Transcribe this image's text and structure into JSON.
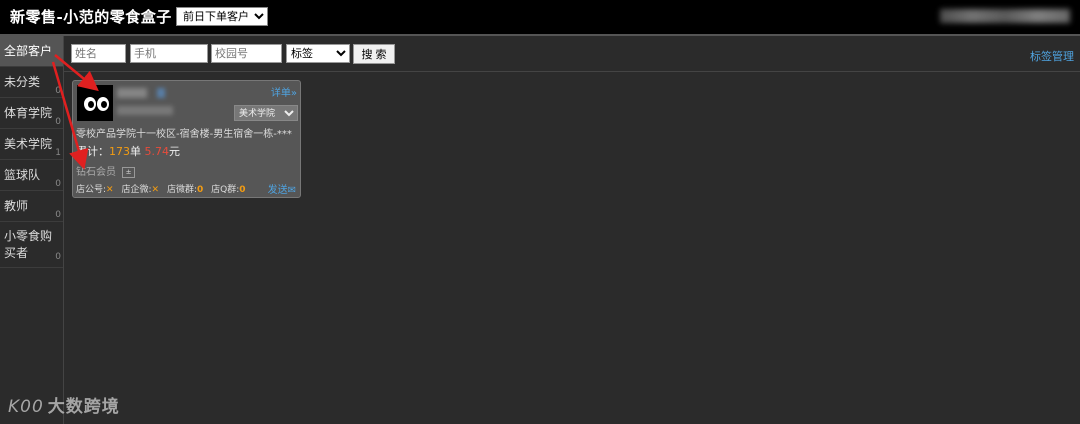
{
  "header": {
    "title": "新零售-小范的零食盒子",
    "filter_selected": "前日下单客户"
  },
  "sidebar": {
    "items": [
      {
        "label": "全部客户",
        "count": "",
        "active": true
      },
      {
        "label": "未分类",
        "count": "0"
      },
      {
        "label": "体育学院",
        "count": "0"
      },
      {
        "label": "美术学院",
        "count": "1"
      },
      {
        "label": "篮球队",
        "count": "0"
      },
      {
        "label": "教师",
        "count": "0"
      },
      {
        "label": "小零食购买者",
        "count": "0"
      }
    ]
  },
  "search": {
    "name_placeholder": "姓名",
    "phone_placeholder": "手机",
    "campus_placeholder": "校园号",
    "tag_selected": "标签",
    "search_label": "搜 索",
    "tag_manage_label": "标签管理"
  },
  "card": {
    "detail_label": "详单»",
    "college_selected": "美术学院",
    "address": "零校产品学院十一校区-宿舍楼-男生宿舍一栋-***",
    "total_prefix": "累计：",
    "total_orders": "173",
    "orders_unit": "单",
    "total_amount": "5.74",
    "amount_unit": "元",
    "member_level": "钻石会员",
    "member_btn": "±",
    "store_account_label": "店公号:",
    "store_account_value": "✕",
    "store_wechat_label": "店企微:",
    "store_wechat_value": "✕",
    "store_group_label": "店微群:",
    "store_group_value": "0",
    "store_qq_label": "店Q群:",
    "store_qq_value": "0",
    "send_label": "发送✉"
  },
  "watermark": {
    "logo": "K00",
    "text": "大数跨境"
  },
  "colors": {
    "accent_link": "#4fa3e0",
    "annotation_arrow": "#e02020",
    "highlight_orange": "#f39c12",
    "highlight_red": "#e74c3c"
  }
}
